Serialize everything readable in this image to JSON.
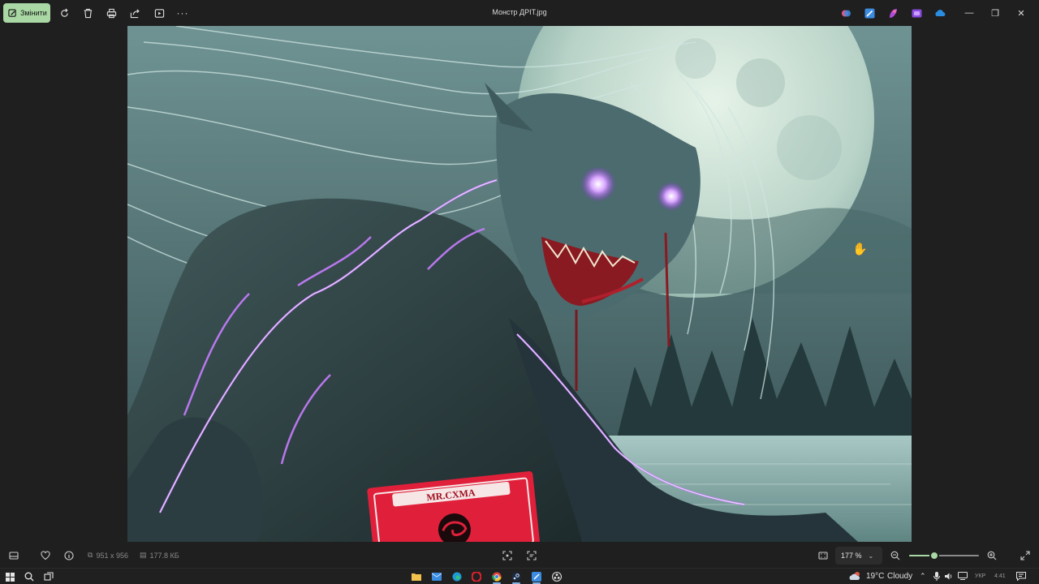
{
  "window": {
    "title": "Монстр ДРІТ.jpg"
  },
  "toolbar": {
    "edit_label": "Змінити",
    "tools": [
      "rotate-icon",
      "delete-icon",
      "print-icon",
      "share-icon",
      "slideshow-icon",
      "more-icon"
    ],
    "more_label": "···"
  },
  "app_icons": [
    {
      "name": "copilot-icon",
      "color": "#e05a8a"
    },
    {
      "name": "image-creator-icon",
      "color": "#3b8be0"
    },
    {
      "name": "designer-icon",
      "color": "#b04ad8"
    },
    {
      "name": "clipchamp-icon",
      "color": "#8a4ae0"
    },
    {
      "name": "onedrive-icon",
      "color": "#2a8de0"
    }
  ],
  "window_controls": {
    "minimize": "—",
    "maximize": "❐",
    "close": "✕"
  },
  "image": {
    "card_text": "MR.CXMA"
  },
  "status": {
    "dimensions": "951 x 956",
    "file_size": "177.8 КБ",
    "zoom": "177 %",
    "zoom_level": 0.36
  },
  "taskbar": {
    "weather_temp": "19°C",
    "weather_text": "Cloudy",
    "lang": "УКР",
    "time": "4:41",
    "pinned": [
      "file-explorer-icon",
      "mail-icon",
      "edge-icon",
      "opera-icon",
      "chrome-icon",
      "steam-icon",
      "image-creator-icon",
      "obs-icon"
    ]
  },
  "colors": {
    "accent": "#a9d8a4",
    "background": "#1f1f1f"
  }
}
